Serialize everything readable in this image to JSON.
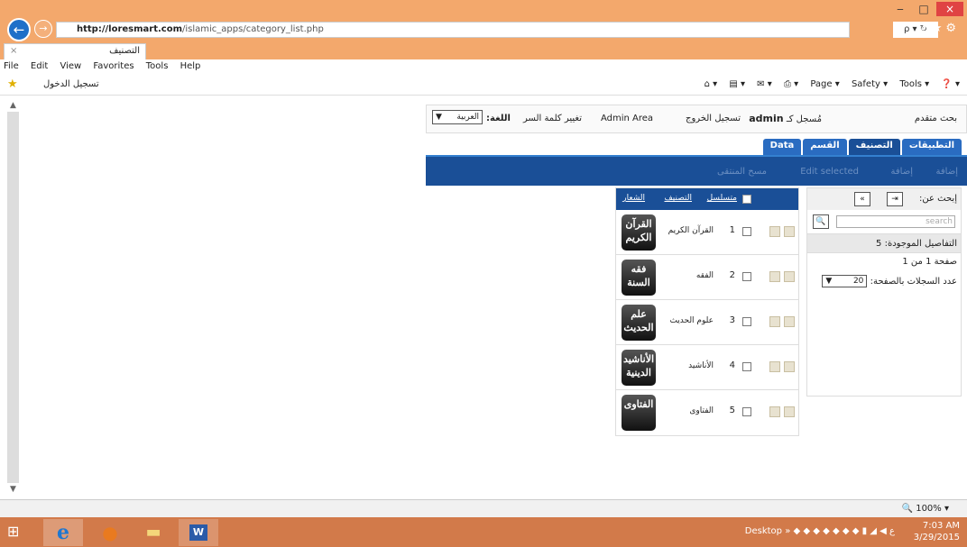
{
  "browser": {
    "url_host": "http://loresmart.com",
    "url_path": "/islamic_apps/category_list.php",
    "addr_tools": "ρ ▾ ↻",
    "tab_title": "التصنيف",
    "tab_close": "×",
    "win_min": "‒",
    "win_max": "□",
    "win_close": "×",
    "menu": [
      "File",
      "Edit",
      "View",
      "Favorites",
      "Tools",
      "Help"
    ],
    "fav_link": "تسجيل الدخول",
    "cmd": [
      "Page ▾",
      "Safety ▾",
      "Tools ▾"
    ],
    "zoom": "🔍 100% ▾"
  },
  "header": {
    "advanced_search": "بحث متقدم",
    "logged_in_prefix": "مُسجل كـ",
    "username": "admin",
    "logout": "تسجيل الخروج",
    "admin_area": "Admin Area",
    "change_password": "تغيير كلمة السر",
    "language_label": "اللغة:",
    "language_value": "العربية"
  },
  "tabs": [
    "التطبيقات",
    "التصنيف",
    "القسم",
    "Data"
  ],
  "toolbar": {
    "add": "إضافة",
    "inline_add": "إضافة",
    "edit_selected": "Edit selected",
    "delete_selected": "مسح المنتقى"
  },
  "search": {
    "label": "إبحث عن:",
    "placeholder": "search",
    "found": "التفاصيل الموجودة: 5",
    "page_info": "صفحة 1 من 1",
    "per_page_label": "عدد السجلات بالصفحة:",
    "per_page_value": "20"
  },
  "grid": {
    "columns": [
      "متسلسل",
      "التصنيف",
      "الشعار"
    ],
    "rows": [
      {
        "num": "1",
        "name": "القرآن الكريم",
        "logo": [
          "القرآن",
          "الكريم"
        ]
      },
      {
        "num": "2",
        "name": "الفقه",
        "logo": [
          "فقه",
          "السنة"
        ]
      },
      {
        "num": "3",
        "name": "علوم الحديث",
        "logo": [
          "علم",
          "الحديث"
        ]
      },
      {
        "num": "4",
        "name": "الأناشيد",
        "logo": [
          "الأناشيد",
          "الدينية"
        ]
      },
      {
        "num": "5",
        "name": "الفتاوى",
        "logo": [
          "الفتاوى",
          ""
        ]
      }
    ]
  },
  "taskbar": {
    "desktop": "Desktop",
    "time": "7:03 AM",
    "date": "3/29/2015"
  }
}
